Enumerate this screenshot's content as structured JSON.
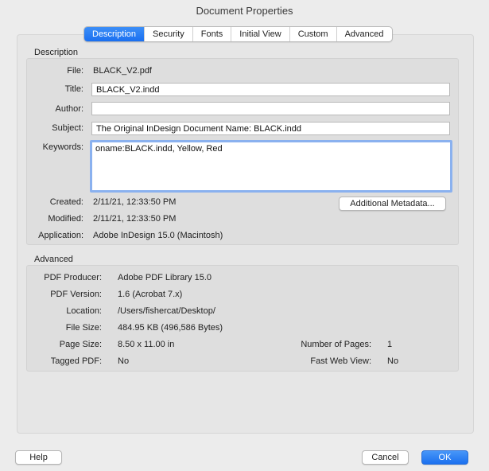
{
  "window": {
    "title": "Document Properties"
  },
  "tabs": [
    "Description",
    "Security",
    "Fonts",
    "Initial View",
    "Custom",
    "Advanced"
  ],
  "description": {
    "section_label": "Description",
    "file_label": "File:",
    "file_value": "BLACK_V2.pdf",
    "title_label": "Title:",
    "title_value": "BLACK_V2.indd",
    "author_label": "Author:",
    "author_value": "",
    "subject_label": "Subject:",
    "subject_value": "The Original InDesign Document Name: BLACK.indd",
    "keywords_label": "Keywords:",
    "keywords_value": "oname:BLACK.indd, Yellow, Red",
    "created_label": "Created:",
    "created_value": "2/11/21, 12:33:50 PM",
    "modified_label": "Modified:",
    "modified_value": "2/11/21, 12:33:50 PM",
    "application_label": "Application:",
    "application_value": "Adobe InDesign 15.0 (Macintosh)",
    "metadata_button": "Additional Metadata..."
  },
  "advanced": {
    "section_label": "Advanced",
    "producer_label": "PDF Producer:",
    "producer_value": "Adobe PDF Library 15.0",
    "version_label": "PDF Version:",
    "version_value": "1.6 (Acrobat 7.x)",
    "location_label": "Location:",
    "location_value": "/Users/fishercat/Desktop/",
    "filesize_label": "File Size:",
    "filesize_value": "484.95 KB (496,586 Bytes)",
    "pagesize_label": "Page Size:",
    "pagesize_value": "8.50 x 11.00 in",
    "pages_label": "Number of Pages:",
    "pages_value": "1",
    "tagged_label": "Tagged PDF:",
    "tagged_value": "No",
    "fastweb_label": "Fast Web View:",
    "fastweb_value": "No"
  },
  "footer": {
    "help": "Help",
    "cancel": "Cancel",
    "ok": "OK"
  }
}
